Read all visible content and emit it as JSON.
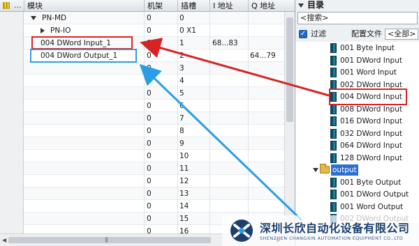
{
  "table": {
    "headers": {
      "extra": "...",
      "module": "模块",
      "rack": "机架",
      "slot": "插槽",
      "i_address": "I 地址",
      "q_address": "Q 地址"
    },
    "rows": [
      {
        "module": "PN-MD",
        "expander": "expanded",
        "rack": "0",
        "slot": "0",
        "i": "",
        "q": ""
      },
      {
        "module": "PN-IO",
        "expander": "collapsed",
        "rack": "0",
        "slot": "0 X1",
        "i": "",
        "q": ""
      },
      {
        "module": "004 DWord Input_1",
        "expander": "",
        "rack": "0",
        "slot": "1",
        "i": "68...83",
        "q": ""
      },
      {
        "module": "004 DWord Output_1",
        "expander": "",
        "rack": "0",
        "slot": "2",
        "i": "",
        "q": "64...79"
      },
      {
        "module": "",
        "expander": "",
        "rack": "0",
        "slot": "3",
        "i": "",
        "q": ""
      },
      {
        "module": "",
        "expander": "",
        "rack": "0",
        "slot": "4",
        "i": "",
        "q": ""
      },
      {
        "module": "",
        "expander": "",
        "rack": "0",
        "slot": "5",
        "i": "",
        "q": ""
      },
      {
        "module": "",
        "expander": "",
        "rack": "0",
        "slot": "6",
        "i": "",
        "q": ""
      },
      {
        "module": "",
        "expander": "",
        "rack": "0",
        "slot": "7",
        "i": "",
        "q": ""
      },
      {
        "module": "",
        "expander": "",
        "rack": "0",
        "slot": "8",
        "i": "",
        "q": ""
      },
      {
        "module": "",
        "expander": "",
        "rack": "0",
        "slot": "9",
        "i": "",
        "q": ""
      },
      {
        "module": "",
        "expander": "",
        "rack": "0",
        "slot": "10",
        "i": "",
        "q": ""
      },
      {
        "module": "",
        "expander": "",
        "rack": "0",
        "slot": "11",
        "i": "",
        "q": ""
      },
      {
        "module": "",
        "expander": "",
        "rack": "0",
        "slot": "12",
        "i": "",
        "q": ""
      },
      {
        "module": "",
        "expander": "",
        "rack": "0",
        "slot": "13",
        "i": "",
        "q": ""
      },
      {
        "module": "",
        "expander": "",
        "rack": "0",
        "slot": "14",
        "i": "",
        "q": ""
      },
      {
        "module": "",
        "expander": "",
        "rack": "0",
        "slot": "15",
        "i": "",
        "q": ""
      },
      {
        "module": "",
        "expander": "",
        "rack": "0",
        "slot": "16",
        "i": "",
        "q": ""
      }
    ]
  },
  "catalog": {
    "title": "目录",
    "search_placeholder": "<搜索>",
    "filter_label": "过滤",
    "filter_checked": true,
    "config_label": "配置文件",
    "config_value": "<全部>",
    "items": [
      {
        "label": "001 Byte Input",
        "kind": "module"
      },
      {
        "label": "001 DWord Input",
        "kind": "module"
      },
      {
        "label": "001 Word Input",
        "kind": "module"
      },
      {
        "label": "002 DWord Input",
        "kind": "module"
      },
      {
        "label": "004 DWord Input",
        "kind": "module"
      },
      {
        "label": "008 DWord Input",
        "kind": "module"
      },
      {
        "label": "016 DWord Input",
        "kind": "module"
      },
      {
        "label": "032 DWord Input",
        "kind": "module"
      },
      {
        "label": "064 DWord Input",
        "kind": "module"
      },
      {
        "label": "128 DWord Input",
        "kind": "module"
      },
      {
        "label": "output",
        "kind": "folder"
      },
      {
        "label": "001 Byte Output",
        "kind": "module"
      },
      {
        "label": "001 DWord Output",
        "kind": "module"
      },
      {
        "label": "001 Word Output",
        "kind": "module"
      },
      {
        "label": "002 DWord Output",
        "kind": "module"
      }
    ]
  },
  "watermark": {
    "company": "深圳长欣自动化设备有限公司",
    "company_en": "SHENZHEN CHANGXIN AUTOMATION EQUIPMENT CO.,LTD"
  },
  "colors": {
    "highlight_red": "#d92323",
    "highlight_blue": "#2a9ee4",
    "selection": "#2d6fd0"
  }
}
